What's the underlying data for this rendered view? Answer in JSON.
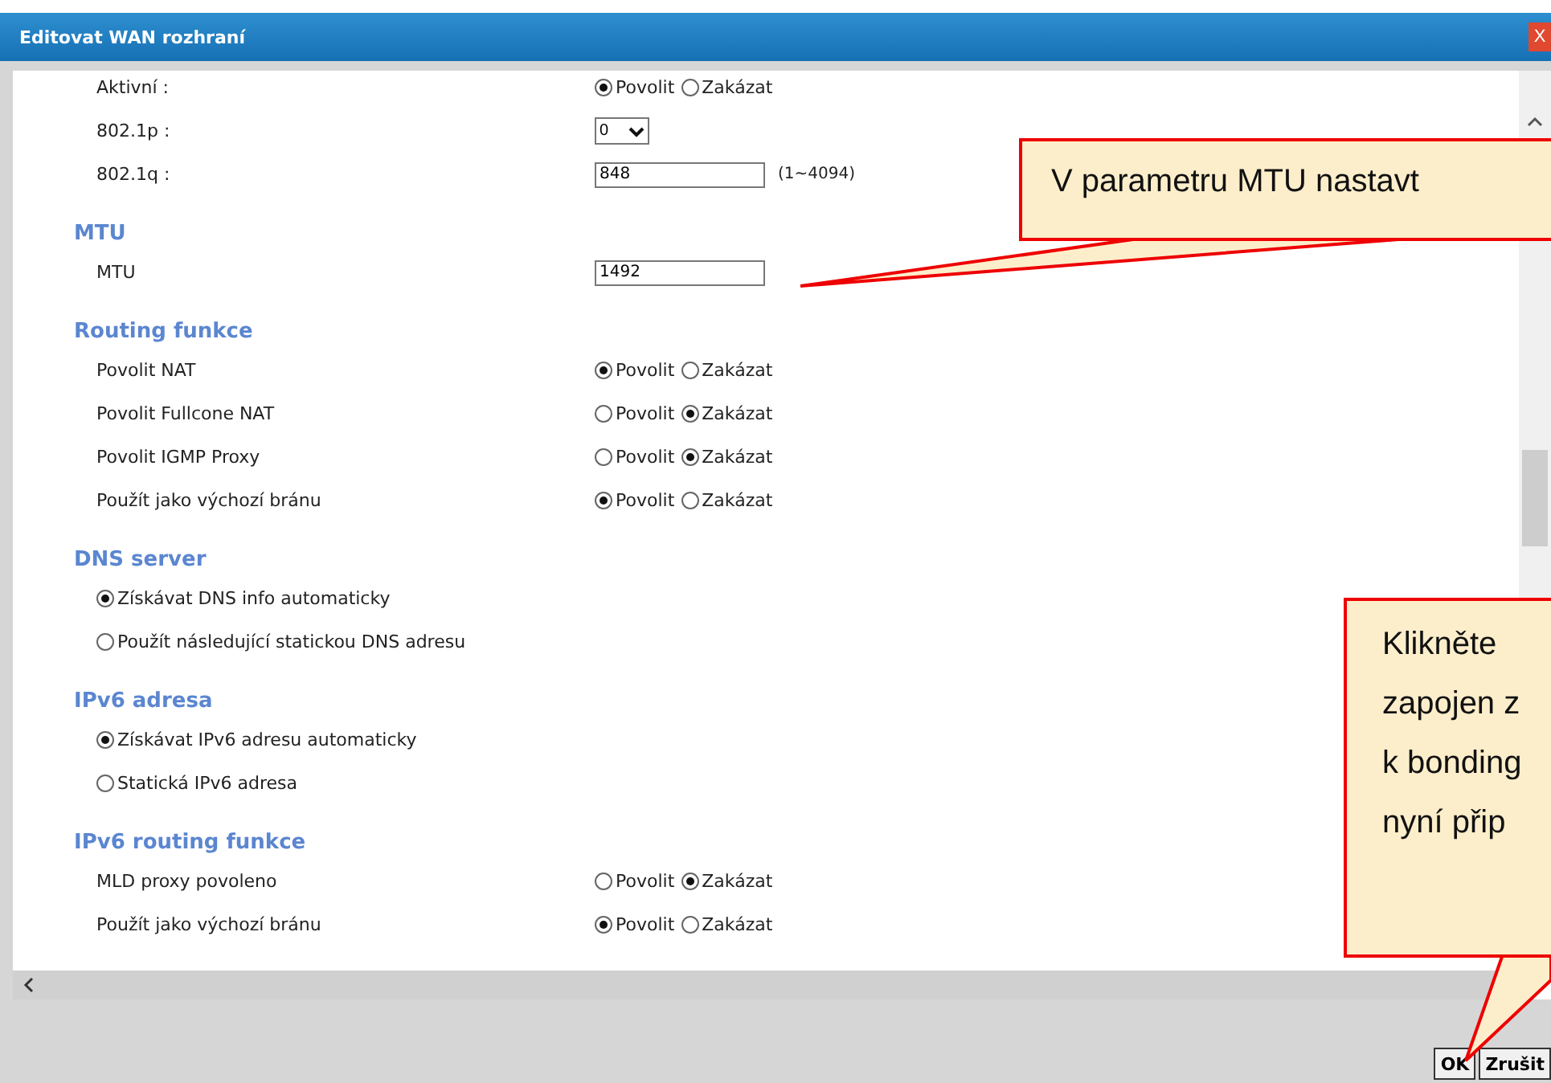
{
  "window": {
    "title": "Editovat WAN rozhraní",
    "close": "X"
  },
  "sections": [
    {
      "rows": [
        {
          "kind": "radio",
          "label": "Aktivní :",
          "options": [
            {
              "label": "Povolit",
              "selected": true
            },
            {
              "label": "Zakázat",
              "selected": false
            }
          ]
        },
        {
          "kind": "select",
          "label": "802.1p :",
          "value": "0"
        },
        {
          "kind": "input",
          "label": "802.1q :",
          "value": "848",
          "hint": "(1~4094)"
        }
      ]
    },
    {
      "title": "MTU",
      "rows": [
        {
          "kind": "input",
          "label": "MTU",
          "value": "1492"
        }
      ]
    },
    {
      "title": "Routing funkce",
      "rows": [
        {
          "kind": "radio",
          "label": "Povolit NAT",
          "options": [
            {
              "label": "Povolit",
              "selected": true
            },
            {
              "label": "Zakázat",
              "selected": false
            }
          ]
        },
        {
          "kind": "radio",
          "label": "Povolit Fullcone NAT",
          "options": [
            {
              "label": "Povolit",
              "selected": false
            },
            {
              "label": "Zakázat",
              "selected": true
            }
          ]
        },
        {
          "kind": "radio",
          "label": "Povolit IGMP Proxy",
          "options": [
            {
              "label": "Povolit",
              "selected": false
            },
            {
              "label": "Zakázat",
              "selected": true
            }
          ]
        },
        {
          "kind": "radio",
          "label": "Použít jako výchozí bránu",
          "options": [
            {
              "label": "Povolit",
              "selected": true
            },
            {
              "label": "Zakázat",
              "selected": false
            }
          ]
        }
      ]
    },
    {
      "title": "DNS server",
      "rows": [
        {
          "kind": "choice",
          "label": "Získávat DNS info automaticky",
          "selected": true
        },
        {
          "kind": "choice",
          "label": "Použít následující statickou DNS adresu",
          "selected": false
        }
      ]
    },
    {
      "title": "IPv6 adresa",
      "rows": [
        {
          "kind": "choice",
          "label": "Získávat IPv6 adresu automaticky",
          "selected": true
        },
        {
          "kind": "choice",
          "label": "Statická IPv6 adresa",
          "selected": false
        }
      ]
    },
    {
      "title": "IPv6 routing funkce",
      "rows": [
        {
          "kind": "radio",
          "label": "MLD proxy povoleno",
          "options": [
            {
              "label": "Povolit",
              "selected": false
            },
            {
              "label": "Zakázat",
              "selected": true
            }
          ]
        },
        {
          "kind": "radio",
          "label": "Použít jako výchozí bránu",
          "options": [
            {
              "label": "Povolit",
              "selected": true
            },
            {
              "label": "Zakázat",
              "selected": false
            }
          ]
        }
      ]
    }
  ],
  "buttons": [
    "OK",
    "Zrušit"
  ],
  "callouts": [
    {
      "lines": [
        "V parametru MTU nastavt"
      ]
    },
    {
      "lines": [
        "Klikněte",
        "zapojen z",
        "k bonding",
        "nyní přip"
      ]
    }
  ]
}
